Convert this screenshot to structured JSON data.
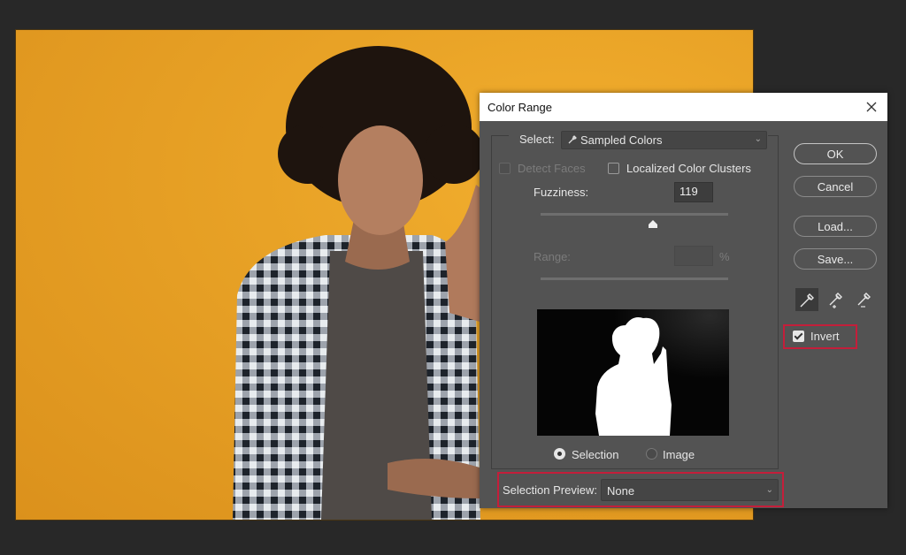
{
  "dialog": {
    "title": "Color Range",
    "select_label": "Select:",
    "select_value": "Sampled Colors",
    "select_icon": "eyedropper-icon",
    "detect_faces": {
      "label": "Detect Faces",
      "checked": false,
      "enabled": false
    },
    "localized_clusters": {
      "label": "Localized Color Clusters",
      "checked": false
    },
    "fuzziness": {
      "label": "Fuzziness:",
      "value": "119",
      "slider_fraction": 0.6
    },
    "range": {
      "label": "Range:",
      "value": "",
      "unit": "%",
      "enabled": false
    },
    "preview_mode": {
      "options": [
        "Selection",
        "Image"
      ],
      "selected": "Selection"
    },
    "selection_preview": {
      "label": "Selection Preview:",
      "value": "None"
    },
    "buttons": {
      "ok": "OK",
      "cancel": "Cancel",
      "load": "Load...",
      "save": "Save..."
    },
    "eyedroppers": [
      "eyedropper-icon",
      "eyedropper-add-icon",
      "eyedropper-subtract-icon"
    ],
    "invert": {
      "label": "Invert",
      "checked": true
    }
  },
  "colors": {
    "highlight": "#c41e3a",
    "background": "#f0a82a"
  }
}
